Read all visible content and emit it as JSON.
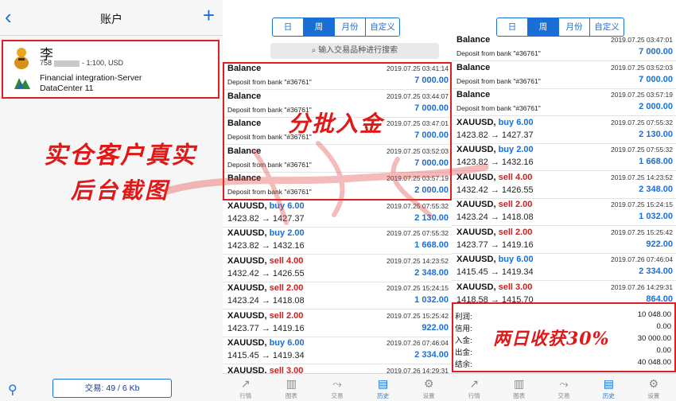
{
  "panel1": {
    "title": "账户",
    "account": {
      "name": "李",
      "number": "758",
      "leverage": "- 1:100, USD",
      "server_line1": "Financial integration-Server",
      "server_line2": "DataCenter 11"
    },
    "promo_line1": "实仓客户真实",
    "promo_line2": "后台截图",
    "trade_button": "交易: 49 / 6 Kb"
  },
  "panel2": {
    "segments": [
      "日",
      "周",
      "月份",
      "自定义"
    ],
    "active_segment": "周",
    "search_placeholder": "输入交易品种进行搜索",
    "promo": "分批入金",
    "rows": [
      {
        "title": "Balance",
        "side": "",
        "date": "2019.07.25 03:41:14",
        "sub": "Deposit from bank \"#36761\"",
        "amount": "7 000.00"
      },
      {
        "title": "Balance",
        "side": "",
        "date": "2019.07.25 03:44:07",
        "sub": "Deposit from bank \"#36761\"",
        "amount": "7 000.00"
      },
      {
        "title": "Balance",
        "side": "",
        "date": "2019.07.25 03:47:01",
        "sub": "Deposit from bank \"#36761\"",
        "amount": "7 000.00"
      },
      {
        "title": "Balance",
        "side": "",
        "date": "2019.07.25 03:52:03",
        "sub": "Deposit from bank \"#36761\"",
        "amount": "7 000.00"
      },
      {
        "title": "Balance",
        "side": "",
        "date": "2019.07.25 03:57:19",
        "sub": "Deposit from bank \"#36761\"",
        "amount": "2 000.00"
      },
      {
        "title": "XAUUSD,",
        "side": "buy 6.00",
        "date": "2019.07.25 07:55:32",
        "sub": "1423.82 → 1427.37",
        "amount": "2 130.00"
      },
      {
        "title": "XAUUSD,",
        "side": "buy 2.00",
        "date": "2019.07.25 07:55:32",
        "sub": "1423.82 → 1432.16",
        "amount": "1 668.00"
      },
      {
        "title": "XAUUSD,",
        "side": "sell 4.00",
        "date": "2019.07.25 14:23:52",
        "sub": "1432.42 → 1426.55",
        "amount": "2 348.00"
      },
      {
        "title": "XAUUSD,",
        "side": "sell 2.00",
        "date": "2019.07.25 15:24:15",
        "sub": "1423.24 → 1418.08",
        "amount": "1 032.00"
      },
      {
        "title": "XAUUSD,",
        "side": "sell 2.00",
        "date": "2019.07.25 15:25:42",
        "sub": "1423.77 → 1419.16",
        "amount": "922.00"
      },
      {
        "title": "XAUUSD,",
        "side": "buy 6.00",
        "date": "2019.07.26 07:46:04",
        "sub": "1415.45 → 1419.34",
        "amount": "2 334.00"
      },
      {
        "title": "XAUUSD,",
        "side": "sell 3.00",
        "date": "2019.07.26 14:29:31",
        "sub": "",
        "amount": ""
      }
    ]
  },
  "panel3": {
    "segments": [
      "日",
      "周",
      "月份",
      "自定义"
    ],
    "active_segment": "周",
    "rows": [
      {
        "title": "Balance",
        "side": "",
        "date": "2019.07.25 03:47:01",
        "sub": "Deposit from bank \"#36761\"",
        "amount": "7 000.00"
      },
      {
        "title": "Balance",
        "side": "",
        "date": "2019.07.25 03:52:03",
        "sub": "Deposit from bank \"#36761\"",
        "amount": "7 000.00"
      },
      {
        "title": "Balance",
        "side": "",
        "date": "2019.07.25 03:57:19",
        "sub": "Deposit from bank \"#36761\"",
        "amount": "2 000.00"
      },
      {
        "title": "XAUUSD,",
        "side": "buy 6.00",
        "date": "2019.07.25 07:55:32",
        "sub": "1423.82 → 1427.37",
        "amount": "2 130.00"
      },
      {
        "title": "XAUUSD,",
        "side": "buy 2.00",
        "date": "2019.07.25 07:55:32",
        "sub": "1423.82 → 1432.16",
        "amount": "1 668.00"
      },
      {
        "title": "XAUUSD,",
        "side": "sell 4.00",
        "date": "2019.07.25 14:23:52",
        "sub": "1432.42 → 1426.55",
        "amount": "2 348.00"
      },
      {
        "title": "XAUUSD,",
        "side": "sell 2.00",
        "date": "2019.07.25 15:24:15",
        "sub": "1423.24 → 1418.08",
        "amount": "1 032.00"
      },
      {
        "title": "XAUUSD,",
        "side": "sell 2.00",
        "date": "2019.07.25 15:25:42",
        "sub": "1423.77 → 1419.16",
        "amount": "922.00"
      },
      {
        "title": "XAUUSD,",
        "side": "buy 6.00",
        "date": "2019.07.26 07:46:04",
        "sub": "1415.45 → 1419.34",
        "amount": "2 334.00"
      },
      {
        "title": "XAUUSD,",
        "side": "sell 3.00",
        "date": "2019.07.26 14:29:31",
        "sub": "1418.58 → 1415.70",
        "amount": "864.00"
      }
    ],
    "summary": [
      {
        "k": "利润:",
        "v": "10 048.00"
      },
      {
        "k": "信用:",
        "v": "0.00"
      },
      {
        "k": "入金:",
        "v": "30 000.00"
      },
      {
        "k": "出金:",
        "v": "0.00"
      },
      {
        "k": "结余:",
        "v": "40 048.00"
      }
    ],
    "promo": "两日收获30%"
  },
  "tabs": [
    {
      "label": "行情",
      "icon": "quotes-icon"
    },
    {
      "label": "图表",
      "icon": "chart-icon"
    },
    {
      "label": "交易",
      "icon": "trade-icon"
    },
    {
      "label": "历史",
      "icon": "history-icon"
    },
    {
      "label": "设置",
      "icon": "settings-icon"
    }
  ],
  "active_tab": "历史",
  "colors": {
    "accent": "#1a6fd6",
    "sell": "#cc1f1f",
    "highlight": "#e02020"
  }
}
